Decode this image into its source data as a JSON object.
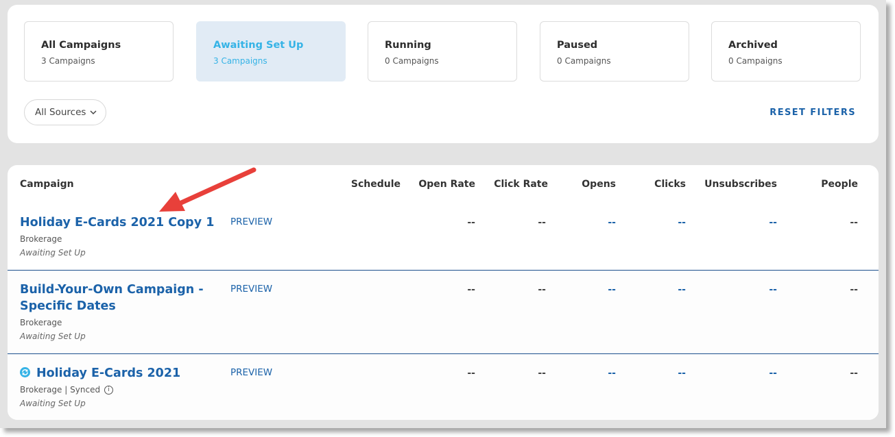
{
  "status_cards": [
    {
      "title": "All Campaigns",
      "count": "3 Campaigns",
      "active": false
    },
    {
      "title": "Awaiting Set Up",
      "count": "3 Campaigns",
      "active": true
    },
    {
      "title": "Running",
      "count": "0 Campaigns",
      "active": false
    },
    {
      "title": "Paused",
      "count": "0 Campaigns",
      "active": false
    },
    {
      "title": "Archived",
      "count": "0 Campaigns",
      "active": false
    }
  ],
  "filters": {
    "sources_label": "All Sources",
    "reset_label": "RESET FILTERS"
  },
  "table": {
    "columns": [
      "Campaign",
      "Schedule",
      "Open Rate",
      "Click Rate",
      "Opens",
      "Clicks",
      "Unsubscribes",
      "People"
    ],
    "rows": [
      {
        "name": "Holiday E-Cards 2021 Copy 1",
        "source": "Brokerage",
        "status": "Awaiting Set Up",
        "preview": "PREVIEW",
        "open_rate": "--",
        "click_rate": "--",
        "opens": "--",
        "clicks": "--",
        "unsubscribes": "--",
        "people": "--"
      },
      {
        "name_line1": "Build-Your-Own Campaign -",
        "name_line2": "Specific Dates",
        "source": "Brokerage",
        "status": "Awaiting Set Up",
        "preview": "PREVIEW",
        "open_rate": "--",
        "click_rate": "--",
        "opens": "--",
        "clicks": "--",
        "unsubscribes": "--",
        "people": "--"
      },
      {
        "name": "Holiday E-Cards 2021",
        "source": "Brokerage",
        "sync_separator": "|",
        "sync_label": "Synced",
        "info_glyph": "i",
        "status": "Awaiting Set Up",
        "preview": "PREVIEW",
        "open_rate": "--",
        "click_rate": "--",
        "opens": "--",
        "clicks": "--",
        "unsubscribes": "--",
        "people": "--"
      }
    ]
  },
  "colors": {
    "accent": "#35b3e6",
    "link": "#1b62a9",
    "active_card_bg": "#e1ebf5",
    "annotation_arrow": "#e8403a"
  }
}
